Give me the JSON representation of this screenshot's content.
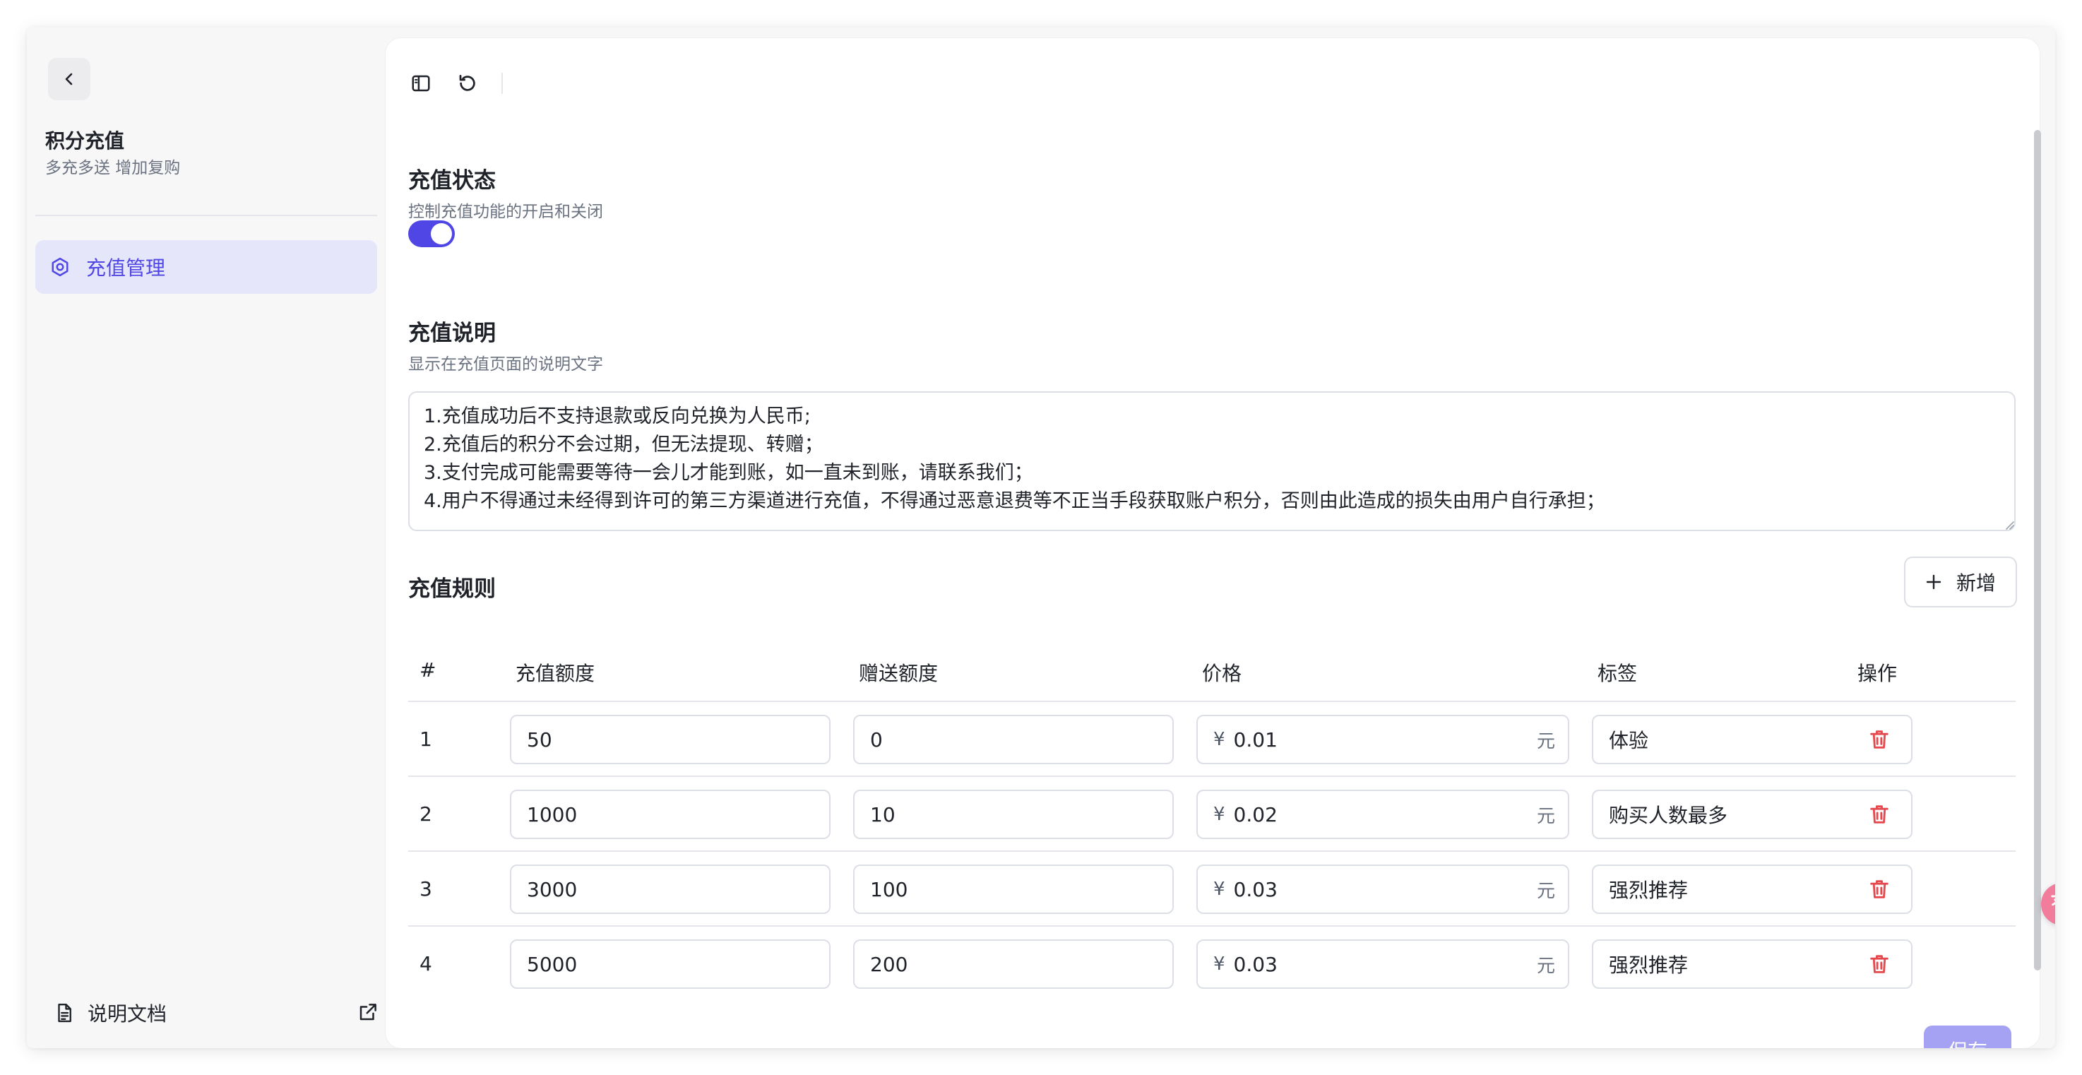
{
  "sidebar": {
    "title": "积分充值",
    "subtitle": "多充多送 增加复购",
    "nav_items": [
      {
        "label": "充值管理",
        "icon": "settings-hex-icon",
        "active": true
      }
    ],
    "doc_link_label": "说明文档"
  },
  "status_section": {
    "title": "充值状态",
    "description": "控制充值功能的开启和关闭",
    "enabled": true
  },
  "desc_section": {
    "title": "充值说明",
    "description": "显示在充值页面的说明文字",
    "text": "1.充值成功后不支持退款或反向兑换为人民币;\n2.充值后的积分不会过期，但无法提现、转赠；\n3.支付完成可能需要等待一会儿才能到账，如一直未到账，请联系我们；\n4.用户不得通过未经得到许可的第三方渠道进行充值，不得通过恶意退费等不正当手段获取账户积分，否则由此造成的损失由用户自行承担；"
  },
  "rules_section": {
    "title": "充值规则",
    "add_label": "新增",
    "columns": [
      "#",
      "充值额度",
      "赠送额度",
      "价格",
      "标签",
      "操作"
    ],
    "currency_prefix": "¥",
    "currency_suffix": "元",
    "rows": [
      {
        "index": "1",
        "amount": "50",
        "bonus": "0",
        "price": "0.01",
        "tag": "体验"
      },
      {
        "index": "2",
        "amount": "1000",
        "bonus": "10",
        "price": "0.02",
        "tag": "购买人数最多"
      },
      {
        "index": "3",
        "amount": "3000",
        "bonus": "100",
        "price": "0.03",
        "tag": "强烈推荐"
      },
      {
        "index": "4",
        "amount": "5000",
        "bonus": "200",
        "price": "0.03",
        "tag": "强烈推荐"
      }
    ]
  },
  "save_label": "保存",
  "colors": {
    "accent": "#4f46e5",
    "danger": "#e5484d",
    "nav_active_bg": "#e5e6fa",
    "save_disabled": "#a5a2f3"
  }
}
